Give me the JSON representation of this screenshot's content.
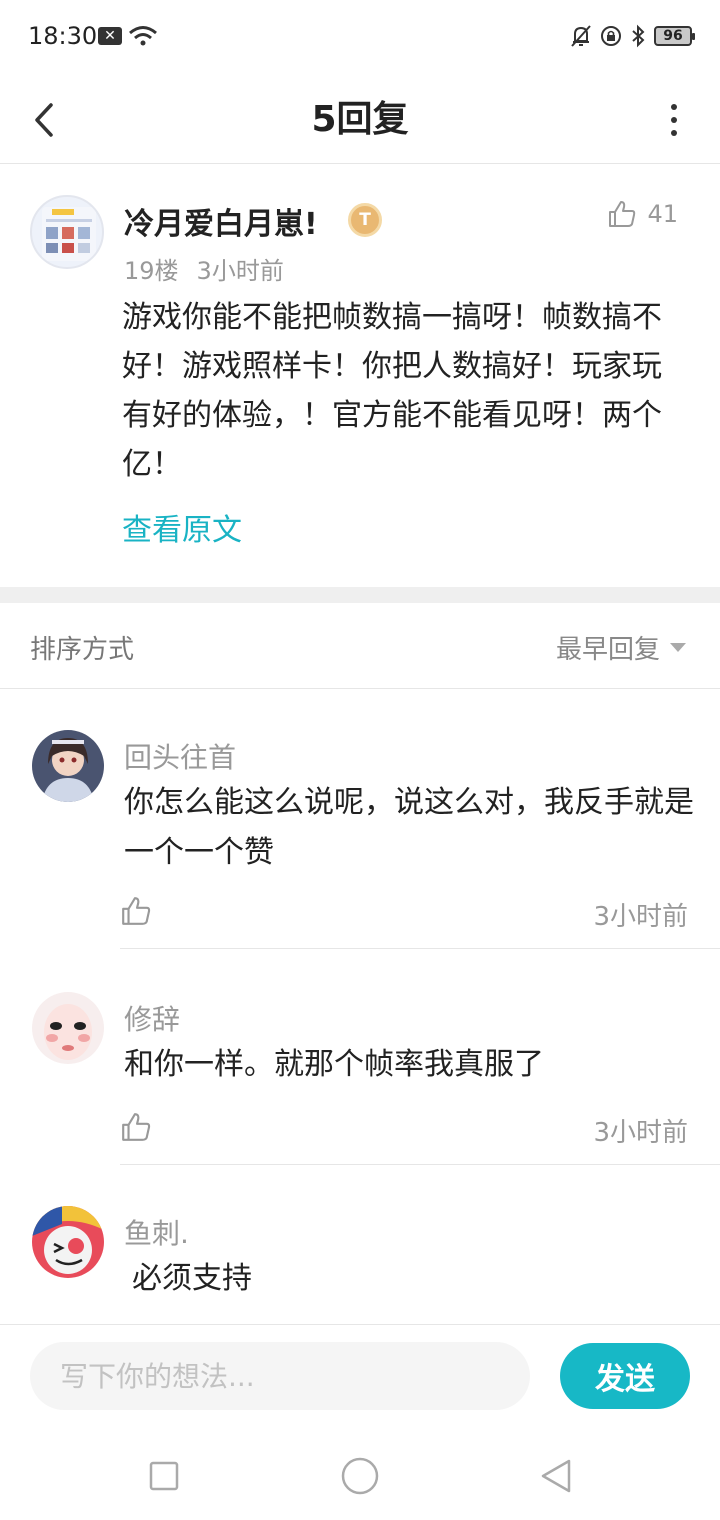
{
  "status_bar": {
    "time": "18:30",
    "battery": "96",
    "icons": [
      "notification-x-icon",
      "wifi-icon",
      "bell-off-icon",
      "lock-rotation-icon",
      "bluetooth-icon",
      "battery-icon"
    ]
  },
  "header": {
    "title": "5回复",
    "back_icon": "chevron-left-icon",
    "more_icon": "more-vertical-icon"
  },
  "post": {
    "username": "冷月爱白月崽!",
    "badge": "T",
    "likes": "41",
    "floor": "19楼",
    "time": "3小时前",
    "content": "游戏你能不能把帧数搞一搞呀！帧数搞不好！游戏照样卡！你把人数搞好！玩家玩有好的体验，！官方能不能看见呀！两个亿！",
    "view_original": "查看原文"
  },
  "sort": {
    "label": "排序方式",
    "selected": "最早回复"
  },
  "replies": [
    {
      "username": "回头往首",
      "text": "你怎么能这么说呢，说这么对，我反手就是一个一个赞",
      "time": "3小时前"
    },
    {
      "username": "修辞",
      "text": "和你一样。就那个帧率我真服了",
      "time": "3小时前"
    },
    {
      "username": "鱼刺.",
      "text": "必须支持",
      "time": ""
    }
  ],
  "composer": {
    "placeholder": "写下你的想法...",
    "send_label": "发送"
  },
  "nav": {
    "icons": [
      "recent-apps-icon",
      "home-icon",
      "back-icon"
    ]
  },
  "colors": {
    "accent": "#17b8c6",
    "link": "#19b3c4",
    "muted_text": "#999999",
    "badge": "#e9b872"
  }
}
